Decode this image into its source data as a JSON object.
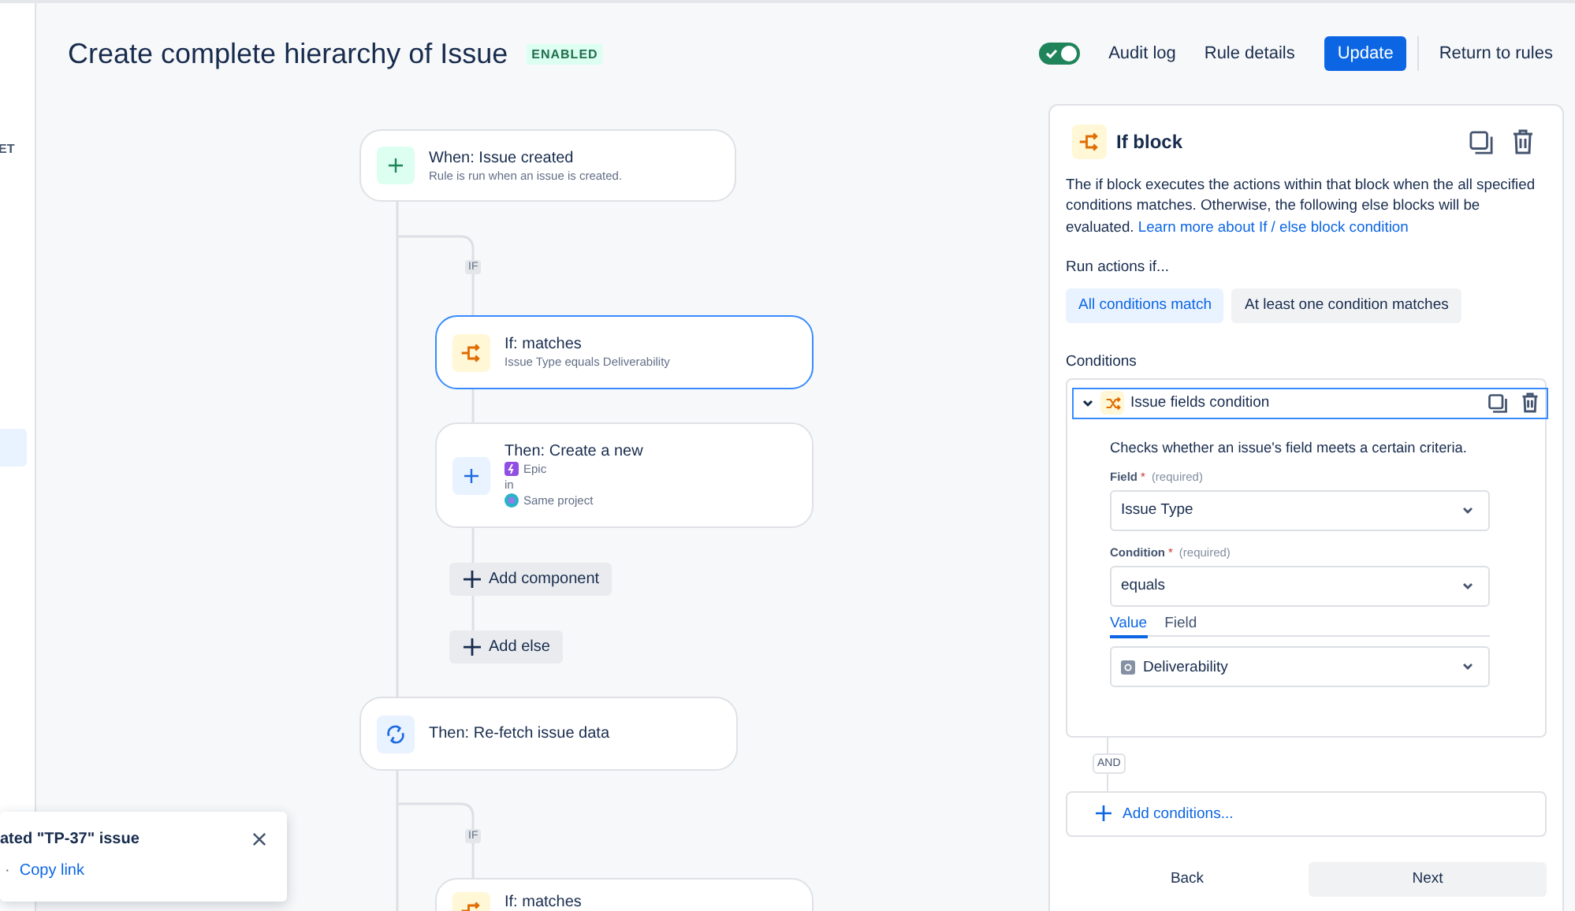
{
  "sidebar": {
    "items": [
      {
        "label": "ET",
        "selected": false
      },
      {
        "selected": true
      }
    ]
  },
  "header": {
    "title": "Create complete hierarchy of Issue",
    "status": "ENABLED",
    "rule_toggle": {
      "on": true
    },
    "links": [
      "Audit log",
      "Rule details"
    ],
    "update_button": "Update",
    "return_link": "Return to rules"
  },
  "diagram": {
    "nodes": [
      {
        "kind": "trigger",
        "title": "When: Issue created",
        "subtitle": "Rule is run when an issue is created.",
        "selected": false
      },
      {
        "kind": "condition",
        "title": "If: matches",
        "subtitle": "Issue Type equals Deliverability",
        "selected": true
      },
      {
        "kind": "create",
        "title": "Then: Create a new",
        "details": [
          {
            "kind": "epic",
            "text": "Epic"
          },
          {
            "kind": "plain",
            "text": "in"
          },
          {
            "kind": "project",
            "text": "Same project"
          }
        ],
        "selected": false
      },
      {
        "kind": "refetch",
        "title": "Then: Re-fetch issue data",
        "selected": false
      },
      {
        "kind": "condition",
        "title": "If: matches",
        "selected": false
      }
    ],
    "branch_labels": [
      "IF",
      "IF"
    ],
    "add_buttons": [
      "Add component",
      "Add else"
    ]
  },
  "panel": {
    "title": "If block",
    "description": "The if block executes the actions within that block when the all specified conditions matches. Otherwise, the following else blocks will be evaluated.",
    "link": "Learn more about If / else block condition",
    "run_label": "Run actions if...",
    "run_options": [
      {
        "label": "All conditions match",
        "selected": true
      },
      {
        "label": "At least one condition matches",
        "selected": false
      }
    ],
    "conditions_label": "Conditions",
    "condition": {
      "title": "Issue fields condition",
      "expanded": true,
      "description": "Checks whether an issue's field meets a certain criteria.",
      "fields": [
        {
          "label": "Field",
          "marker": "*",
          "hint": "(required)",
          "value": "Issue Type"
        },
        {
          "label": "Condition",
          "marker": "*",
          "hint": "(required)",
          "value": "equals"
        }
      ],
      "value_tabs": [
        {
          "label": "Value",
          "selected": true
        },
        {
          "label": "Field",
          "selected": false
        }
      ],
      "value": "Deliverability"
    },
    "joiner": "AND",
    "add_conditions": "Add conditions...",
    "back": "Back",
    "next": "Next"
  },
  "toast": {
    "message": "ated \"TP-37\" issue",
    "separator": "·",
    "link": "Copy link"
  }
}
